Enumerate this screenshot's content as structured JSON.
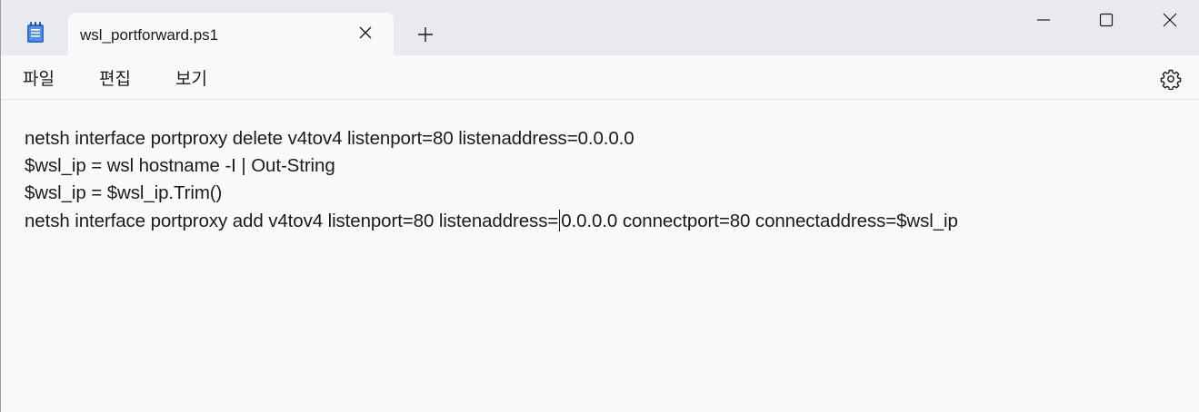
{
  "tab": {
    "title": "wsl_portforward.ps1",
    "app_icon": "notepad-icon",
    "close_icon": "close-icon",
    "new_tab_icon": "plus-icon"
  },
  "window_controls": {
    "minimize_icon": "minimize-icon",
    "maximize_icon": "maximize-icon",
    "close_icon": "close-icon"
  },
  "menu": {
    "file": "파일",
    "edit": "편집",
    "view": "보기",
    "settings_icon": "gear-icon"
  },
  "editor": {
    "lines": [
      "netsh interface portproxy delete v4tov4 listenport=80 listenaddress=0.0.0.0",
      "$wsl_ip = wsl hostname -I | Out-String",
      "$wsl_ip = $wsl_ip.Trim()"
    ],
    "line4_before_caret": "netsh interface portproxy add v4tov4 listenport=80 listenaddress=",
    "line4_after_caret": "0.0.0.0 connectport=80 connectaddress=$wsl_ip"
  },
  "colors": {
    "titlebar_bg": "#e8eaee",
    "content_bg": "#f9f9f9",
    "text": "#1b1b1b",
    "icon_accent": "#2f6ecb"
  }
}
